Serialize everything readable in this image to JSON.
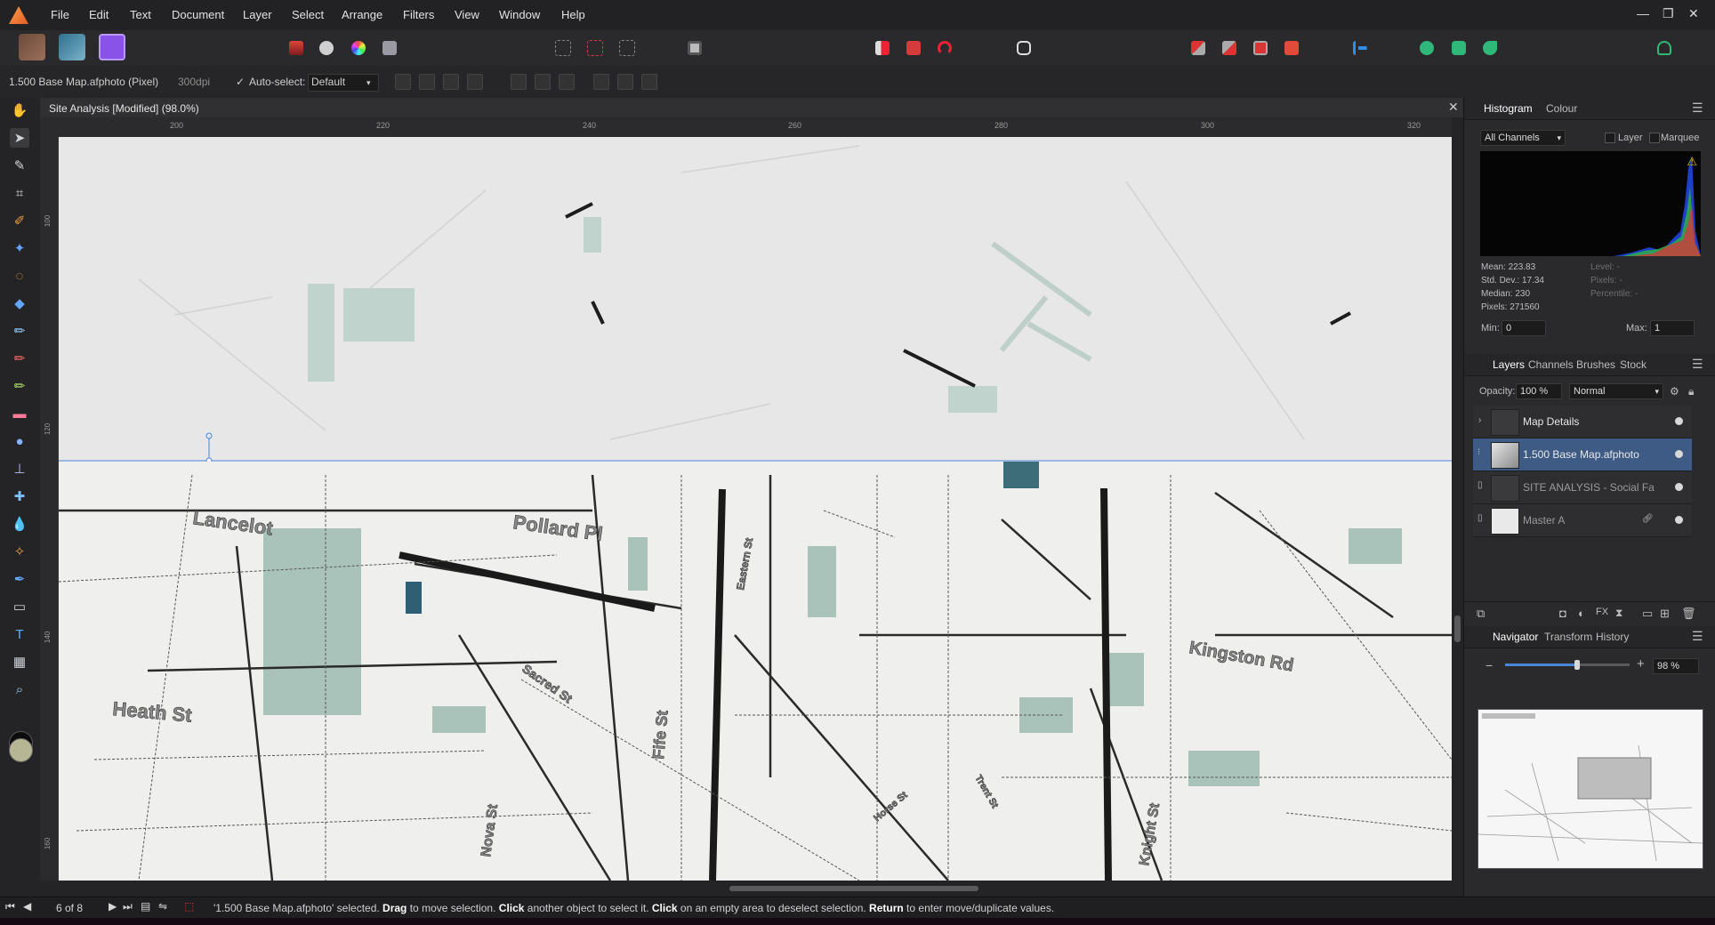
{
  "menubar": {
    "items": [
      "File",
      "Edit",
      "Text",
      "Document",
      "Layer",
      "Select",
      "Arrange",
      "Filters",
      "View",
      "Window",
      "Help"
    ],
    "window_controls": {
      "minimize": "—",
      "restore": "❐",
      "close": "✕"
    }
  },
  "context": {
    "file_label": "1.500 Base Map.afphoto (Pixel)",
    "dpi": "300dpi",
    "autoselect_label": "Auto-select:",
    "autoselect_value": "Default"
  },
  "document": {
    "title": "Site Analysis [Modified] (98.0%)",
    "close": "✕",
    "ruler_h": [
      "200",
      "220",
      "240",
      "260",
      "280",
      "300",
      "320"
    ],
    "ruler_v": [
      "100",
      "120",
      "140",
      "160"
    ],
    "map_labels": [
      "Lancelot",
      "Pollard Pl",
      "Eastern St",
      "Sacred St",
      "Heath St",
      "Fife St",
      "Nova St",
      "Knight St",
      "Trent St",
      "Horse St",
      "Kingston Rd"
    ]
  },
  "histogram_panel": {
    "tabs": [
      "Histogram",
      "Colour"
    ],
    "channel": "All Channels",
    "layer_label": "Layer",
    "marquee_label": "Marquee",
    "stats_left": [
      "Mean: 223.83",
      "Std. Dev.: 17.34",
      "Median: 230",
      "Pixels: 271560"
    ],
    "stats_right": [
      "Level: -",
      "Pixels: -",
      "Percentile: -"
    ],
    "min_label": "Min:",
    "min_value": "0",
    "max_label": "Max:",
    "max_value": "1",
    "warning_icon": "⚠"
  },
  "layers_panel": {
    "tabs": [
      "Layers",
      "Channels",
      "Brushes",
      "Stock"
    ],
    "opacity_label": "Opacity:",
    "opacity_value": "100 %",
    "blend_mode": "Normal",
    "layers": [
      {
        "name": "Map Details"
      },
      {
        "name": "1.500 Base Map.afphoto"
      },
      {
        "name": "SITE ANALYSIS - Social Fa"
      },
      {
        "name": "Master A"
      }
    ]
  },
  "navigator_panel": {
    "tabs": [
      "Navigator",
      "Transform",
      "History"
    ],
    "zoom_value": "98 %",
    "zoom_fraction": 0.58
  },
  "statusbar": {
    "page": "6 of 8",
    "msg_1": "'1.500 Base Map.afphoto' selected. ",
    "k_drag": "Drag",
    "msg_2": " to move selection. ",
    "k_click1": "Click",
    "msg_3": " another object to select it. ",
    "k_click2": "Click",
    "msg_4": " on an empty area to deselect selection. ",
    "k_return": "Return",
    "msg_5": " to enter move/duplicate values."
  },
  "colors": {
    "accent": "#3d5b85",
    "persona_photo": "#8a52e6",
    "foreground": "#0c0c0c",
    "background_swatch": "#b6b694"
  }
}
